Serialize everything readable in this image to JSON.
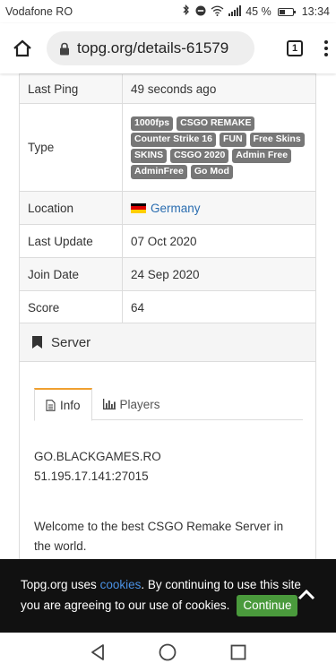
{
  "status": {
    "carrier": "Vodafone RO",
    "battery": "45 %",
    "battery_level": 0.45,
    "time": "13:34"
  },
  "browser": {
    "url": "topg.org/details-61579",
    "tab_count": "1"
  },
  "details": [
    {
      "key": "Last Ping",
      "value": "49 seconds ago"
    },
    {
      "key": "Type",
      "tags": [
        "1000fps",
        "CSGO REMAKE",
        "Counter Strike 16",
        "FUN",
        "Free Skins",
        "SKINS",
        "CSGO 2020",
        "Admin Free",
        "AdminFree",
        "Go Mod"
      ]
    },
    {
      "key": "Location",
      "value": "Germany"
    },
    {
      "key": "Last Update",
      "value": "07 Oct 2020"
    },
    {
      "key": "Join Date",
      "value": "24 Sep 2020"
    },
    {
      "key": "Score",
      "value": "64"
    }
  ],
  "server_panel": {
    "title": "Server",
    "tabs": [
      {
        "label": "Info",
        "active": true
      },
      {
        "label": "Players",
        "active": false
      }
    ],
    "hostname": "GO.BLACKGAMES.RO",
    "address": "51.195.17.141:27015",
    "welcome": "Welcome to the best CSGO Remake Server in",
    "welcome_cont": "the world."
  },
  "cookie": {
    "text_before": "Topg.org uses ",
    "link": "cookies",
    "text_after": ". By continuing to use this site",
    "line2": "you are agreeing to our use of cookies.",
    "button": "Continue"
  }
}
